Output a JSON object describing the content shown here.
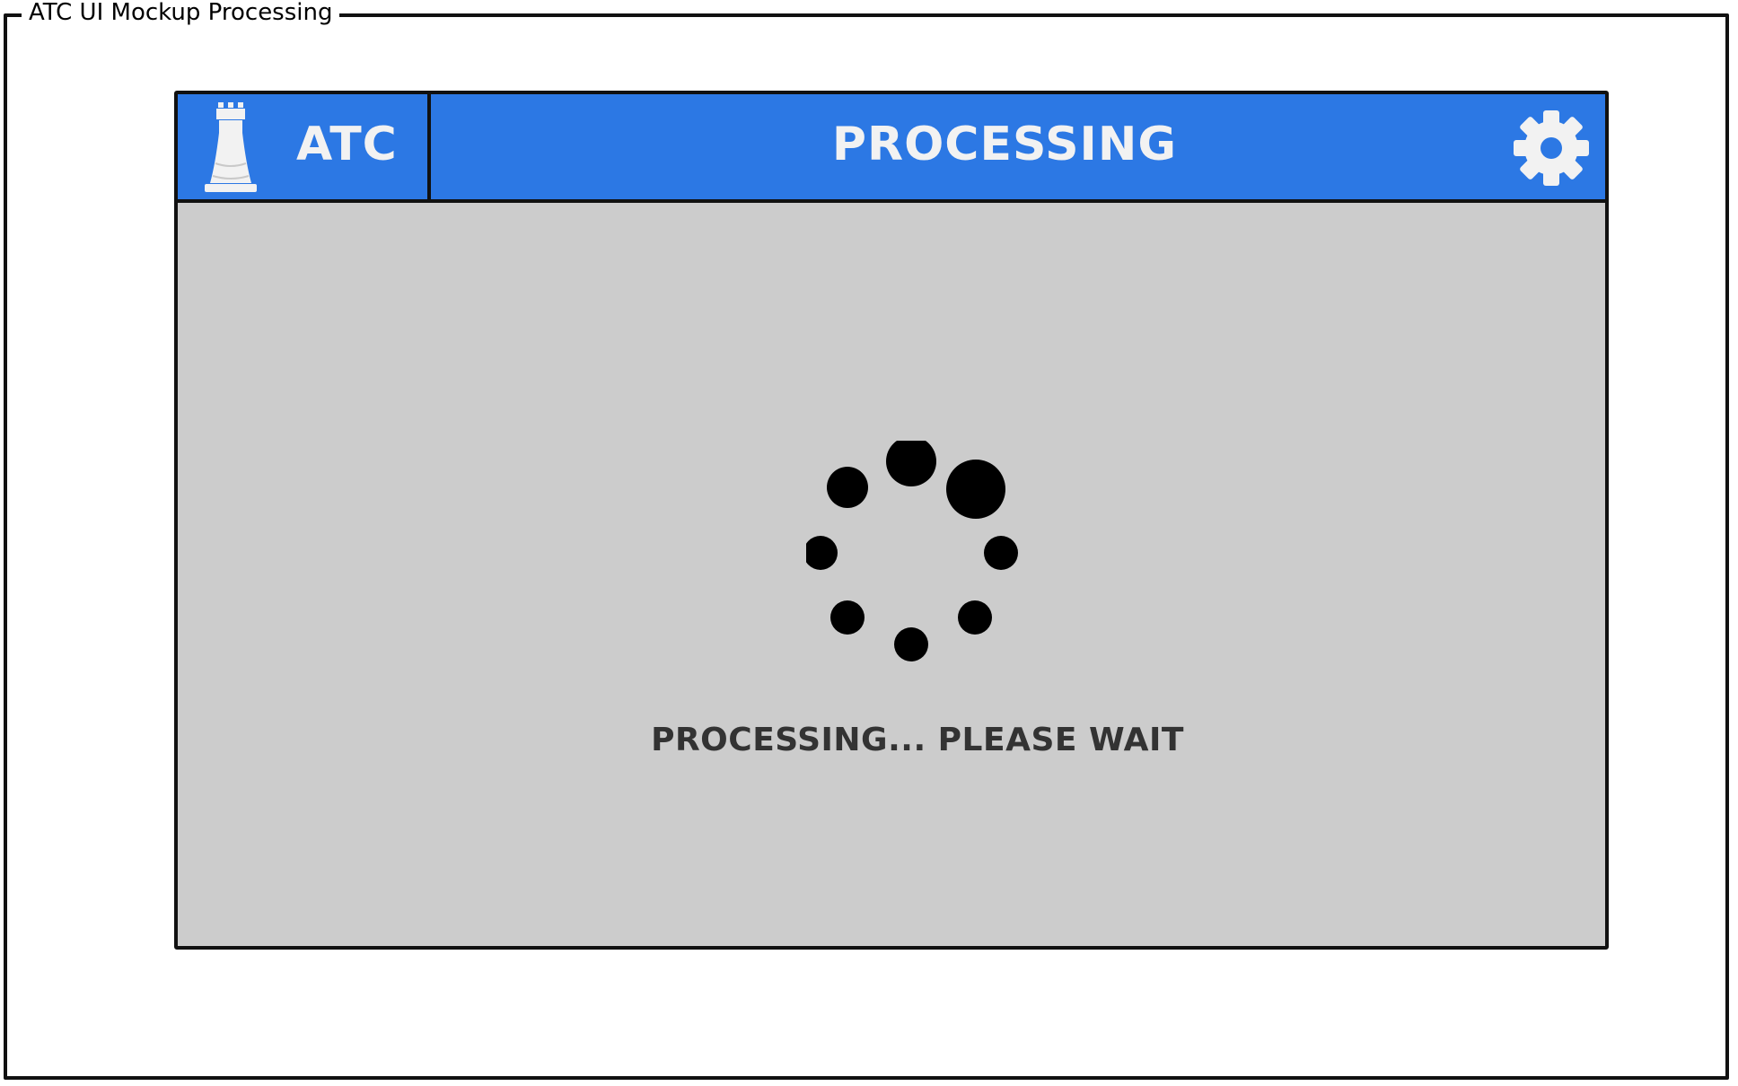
{
  "frame": {
    "title": "ATC UI Mockup Processing"
  },
  "header": {
    "brand_label": "ATC",
    "screen_title": "PROCESSING",
    "logo_icon": "rook-icon",
    "settings_icon": "gear-icon"
  },
  "main": {
    "spinner_icon": "loading-spinner-icon",
    "status_text": "PROCESSING... PLEASE WAIT"
  },
  "colors": {
    "header_bg": "#2c78e4",
    "body_bg": "#cccccc",
    "header_text": "#f2f2f2",
    "status_text": "#333333"
  }
}
